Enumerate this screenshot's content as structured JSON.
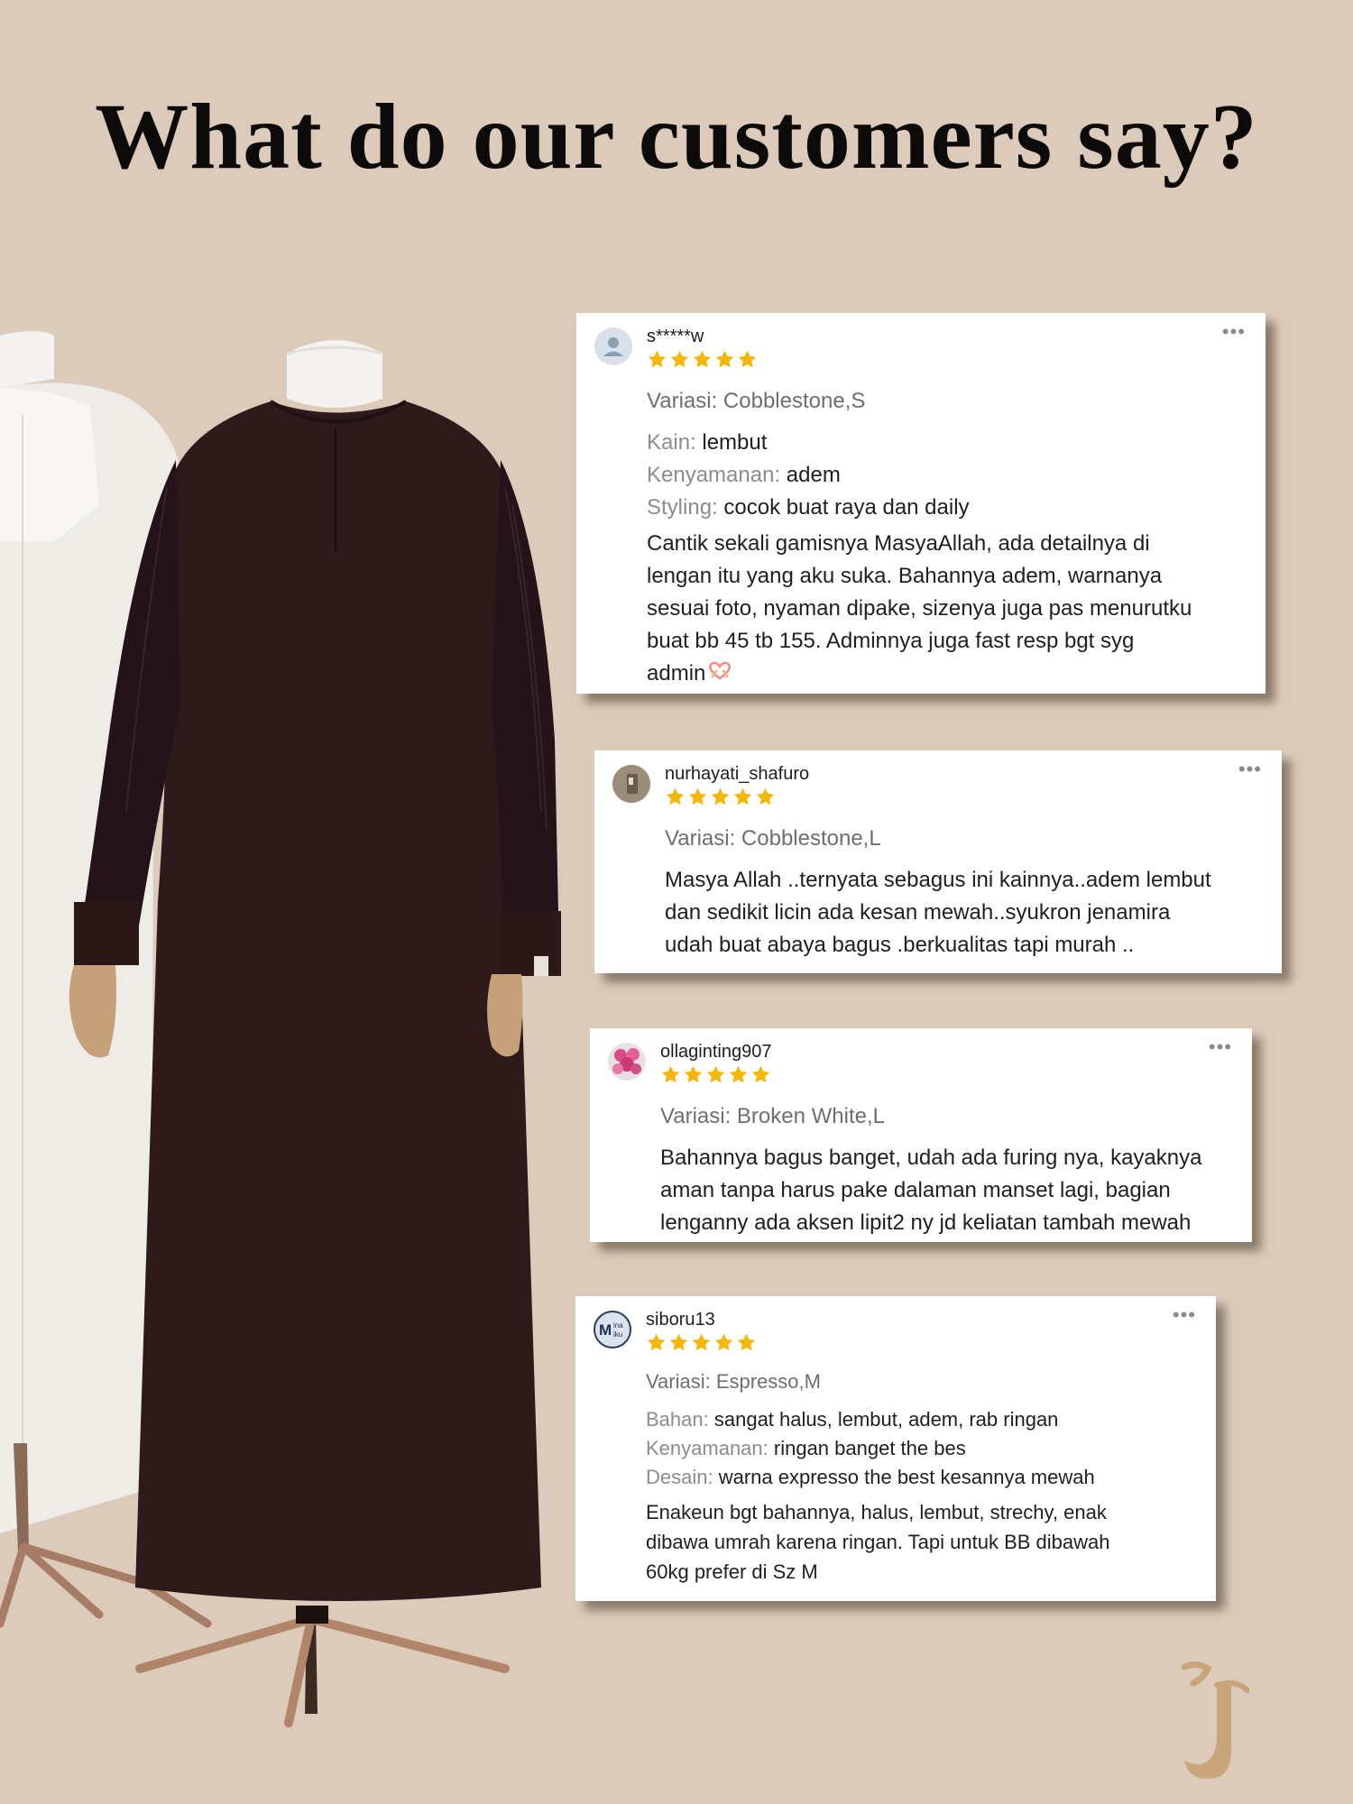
{
  "headline": "What do our customers say?",
  "reviews": [
    {
      "username": "s*****w",
      "avatar_icon": "default-user-icon",
      "rating": 5,
      "variasi": "Variasi: Cobblestone,S",
      "attributes": [
        {
          "key": "Kain:",
          "value": "lembut"
        },
        {
          "key": "Kenyamanan:",
          "value": "adem"
        },
        {
          "key": "Styling:",
          "value": "cocok buat raya dan daily"
        }
      ],
      "lines": [
        "Cantik sekali gamisnya MasyaAllah, ada detailnya di",
        "lengan itu yang aku suka. Bahannya adem, warnanya",
        "sesuai foto, nyaman dipake, sizenya juga pas menurutku",
        "buat bb 45 tb 155. Adminnya juga fast resp bgt syg",
        "admin"
      ],
      "emoji_icon": "heart-hands-icon"
    },
    {
      "username": "nurhayati_shafuro",
      "avatar_icon": "photo-avatar-icon",
      "rating": 5,
      "variasi": "Variasi: Cobblestone,L",
      "attributes": [],
      "lines": [
        "Masya Allah ..ternyata sebagus ini kainnya..adem lembut",
        "dan sedikit licin ada kesan mewah..syukron jenamira",
        "udah buat abaya bagus .berkualitas tapi murah .."
      ]
    },
    {
      "username": "ollaginting907",
      "avatar_icon": "flower-avatar-icon",
      "rating": 5,
      "variasi": "Variasi: Broken White,L",
      "attributes": [],
      "lines": [
        "Bahannya bagus banget, udah ada furing nya, kayaknya",
        "aman tanpa harus pake dalaman manset lagi, bagian",
        "lenganny ada aksen lipit2 ny jd keliatan tambah mewah"
      ]
    },
    {
      "username": "siboru13",
      "avatar_icon": "mina-miku-avatar-icon",
      "avatar_text": "Mina Miku",
      "rating": 5,
      "variasi": "Variasi: Espresso,M",
      "attributes": [
        {
          "key": "Bahan:",
          "value": "sangat halus, lembut, adem, rab ringan"
        },
        {
          "key": "Kenyamanan:",
          "value": "ringan banget the bes"
        },
        {
          "key": "Desain:",
          "value": "warna expresso the best kesannya mewah"
        }
      ],
      "lines": [
        "Enakeun bgt bahannya, halus, lembut, strechy, enak",
        "dibawa umrah karena ringan. Tapi untuk BB dibawah",
        "60kg prefer di Sz M"
      ]
    }
  ],
  "colors": {
    "background": "#dccbba",
    "star": "#f5b60a",
    "dress_dark": "#2e1a1b",
    "dress_light": "#f1f0ec",
    "logo": "#c9a57a"
  },
  "more_label": "•••",
  "brand_logo": "jenamira-j-logo"
}
